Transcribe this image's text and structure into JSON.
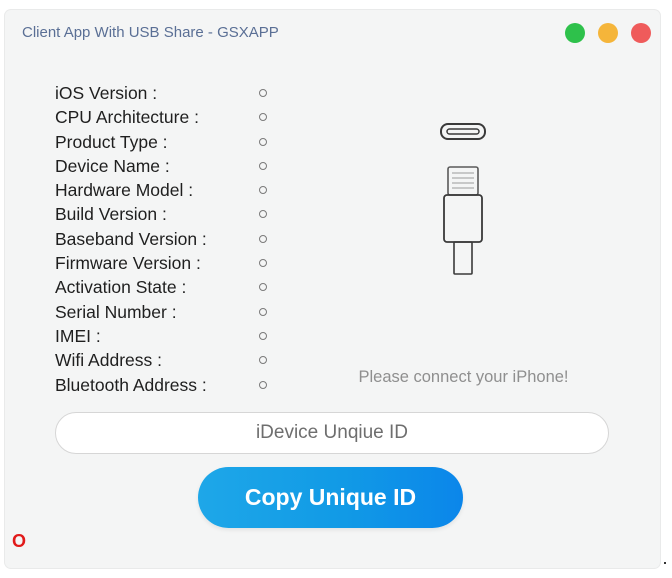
{
  "window": {
    "title": "Client App With USB Share - GSXAPP",
    "controls": {
      "minimize_color": "#2ec14b",
      "maximize_color": "#f5b53a",
      "close_color": "#ef5b5b"
    }
  },
  "device_info": {
    "fields": [
      {
        "label": "iOS Version :",
        "value": ""
      },
      {
        "label": "CPU Architecture :",
        "value": ""
      },
      {
        "label": "Product Type :",
        "value": ""
      },
      {
        "label": "Device Name :",
        "value": ""
      },
      {
        "label": "Hardware Model :",
        "value": ""
      },
      {
        "label": "Build Version :",
        "value": ""
      },
      {
        "label": "Baseband Version :",
        "value": ""
      },
      {
        "label": "Firmware Version :",
        "value": ""
      },
      {
        "label": "Activation State :",
        "value": ""
      },
      {
        "label": "Serial Number :",
        "value": ""
      },
      {
        "label": "IMEI :",
        "value": ""
      },
      {
        "label": "Wifi Address :",
        "value": ""
      },
      {
        "label": "Bluetooth Address :",
        "value": ""
      }
    ]
  },
  "connection": {
    "icon": "lightning-cable-icon",
    "message": "Please connect your iPhone!"
  },
  "unique_id": {
    "placeholder": "iDevice Unqiue ID",
    "value": ""
  },
  "actions": {
    "copy_label": "Copy Unique ID",
    "accent": "#119ae6"
  },
  "status": {
    "indicator": "O",
    "color": "#e11a1a"
  }
}
